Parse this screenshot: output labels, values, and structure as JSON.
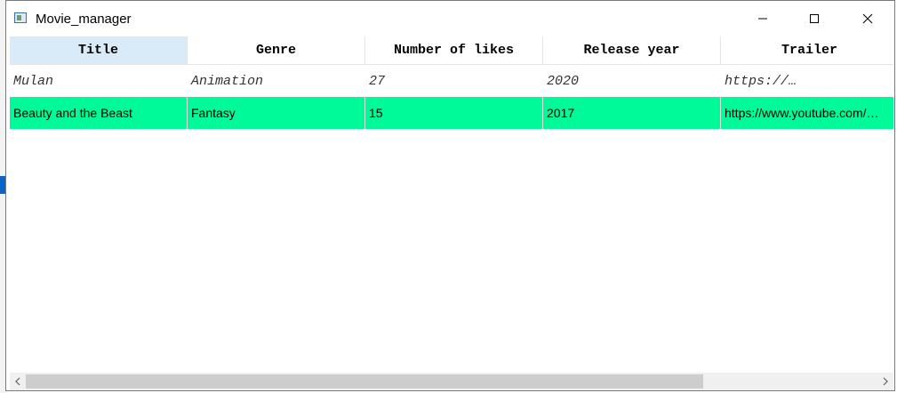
{
  "window": {
    "title": "Movie_manager"
  },
  "table": {
    "headers": [
      "Title",
      "Genre",
      "Number of likes",
      "Release year",
      "Trailer"
    ],
    "rows": [
      [
        "Mulan",
        "Animation",
        "27",
        "2020",
        "https://…"
      ],
      [
        "Beauty and the Beast",
        "Fantasy",
        "15",
        "2017",
        "https://www.youtube.com/…"
      ]
    ],
    "selected_header": "Title",
    "highlight_color": "#00fa9a"
  },
  "icons": {
    "minimize": "minimize-icon",
    "maximize": "maximize-icon",
    "close": "close-icon",
    "scroll_left": "chevron-left-icon",
    "scroll_right": "chevron-right-icon"
  }
}
